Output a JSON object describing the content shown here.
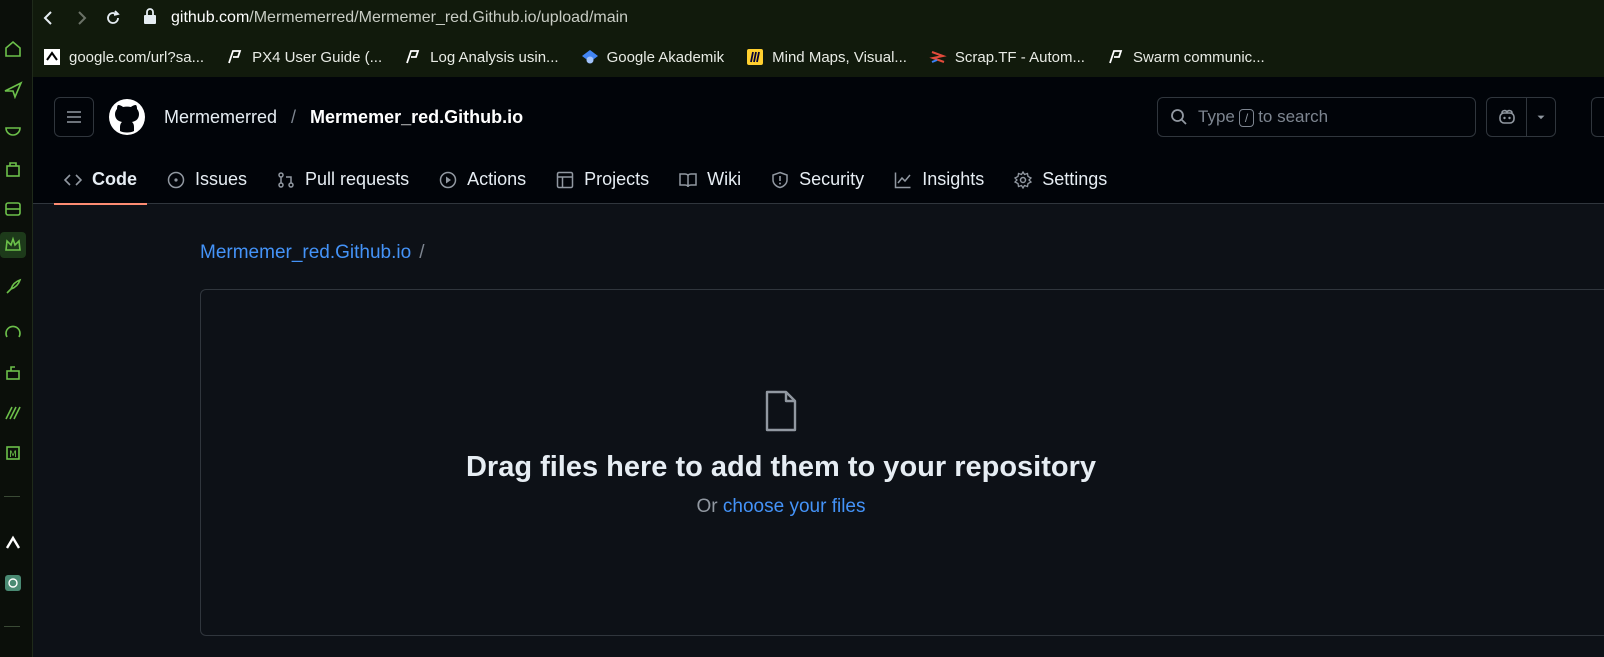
{
  "browser": {
    "url_host": "github.com",
    "url_path": "/Mermemerred/Mermemer_red.Github.io/upload/main",
    "bookmarks": [
      {
        "icon": "google-favicon-icon",
        "label": "google.com/url?sa..."
      },
      {
        "icon": "px4-favicon-icon",
        "label": "PX4 User Guide (..."
      },
      {
        "icon": "px4-favicon-icon",
        "label": "Log Analysis usin..."
      },
      {
        "icon": "scholar-favicon-icon",
        "label": "Google Akademik"
      },
      {
        "icon": "miro-favicon-icon",
        "label": "Mind Maps, Visual..."
      },
      {
        "icon": "scraptf-favicon-icon",
        "label": "Scrap.TF - Autom..."
      },
      {
        "icon": "px4-favicon-icon",
        "label": "Swarm communic..."
      }
    ]
  },
  "github": {
    "owner": "Mermemerred",
    "repo": "Mermemer_red.Github.io",
    "search_before": "Type",
    "search_key": "/",
    "search_after": "to search",
    "tabs": [
      {
        "icon": "code-icon",
        "label": "Code",
        "active": true
      },
      {
        "icon": "issue-icon",
        "label": "Issues"
      },
      {
        "icon": "pull-request-icon",
        "label": "Pull requests"
      },
      {
        "icon": "play-icon",
        "label": "Actions"
      },
      {
        "icon": "table-icon",
        "label": "Projects"
      },
      {
        "icon": "book-icon",
        "label": "Wiki"
      },
      {
        "icon": "shield-icon",
        "label": "Security"
      },
      {
        "icon": "graph-icon",
        "label": "Insights"
      },
      {
        "icon": "gear-icon",
        "label": "Settings"
      }
    ]
  },
  "upload": {
    "breadcrumb_repo": "Mermemer_red.Github.io",
    "breadcrumb_sep": "/",
    "title": "Drag files here to add them to your repository",
    "subtitle_prefix": "Or",
    "subtitle_link": "choose your files"
  },
  "colors": {
    "accent_link": "#4493f8",
    "tab_underline": "#fd8c73",
    "dock_icon": "#6cc04a"
  }
}
